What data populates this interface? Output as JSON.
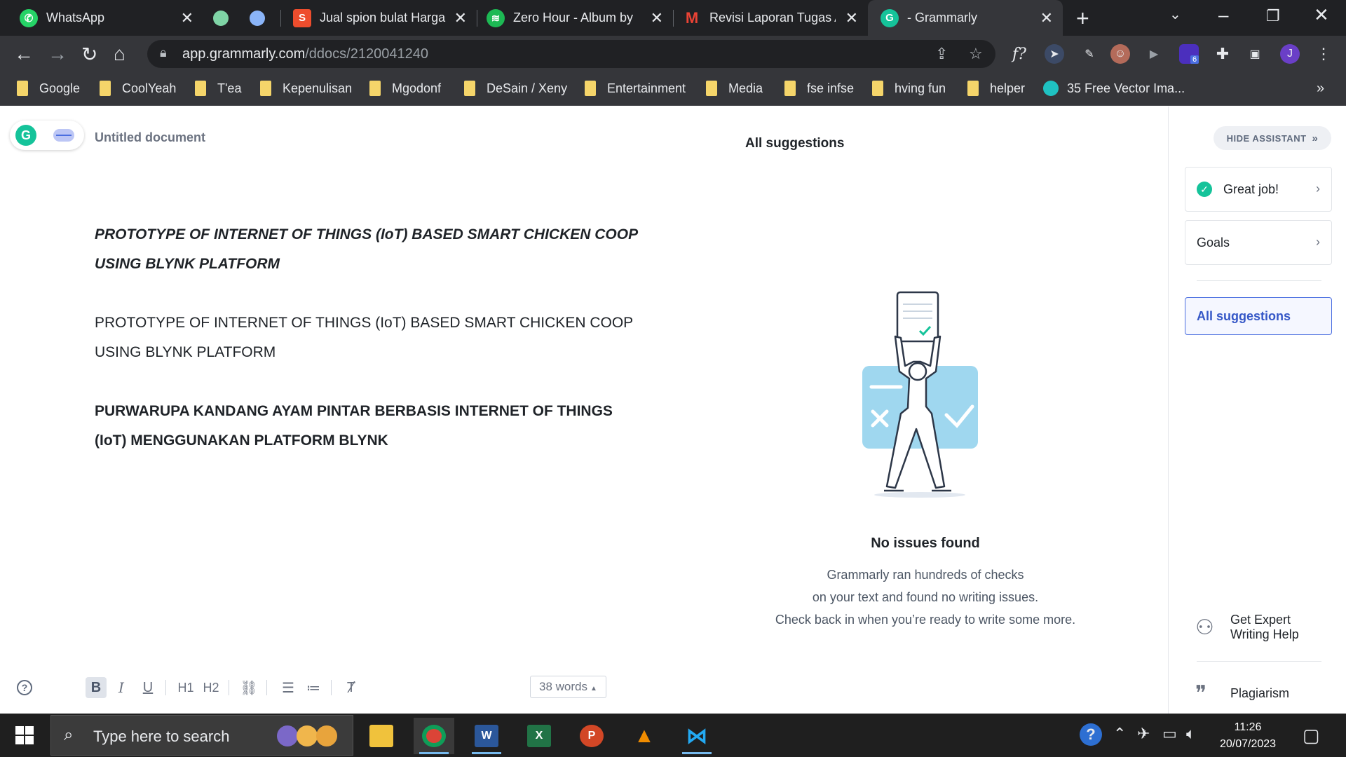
{
  "browser": {
    "tabs": [
      {
        "title": "WhatsApp",
        "icon": "whatsapp-icon",
        "color": "#25d366"
      },
      {
        "title": "",
        "icon": "circle-green-icon",
        "color": "#7fd4a6"
      },
      {
        "title": "",
        "icon": "circle-blue-icon",
        "color": "#8ab4f8"
      },
      {
        "title": "Jual spion bulat Harga",
        "icon": "shopee-icon",
        "color": "#ee4d2d"
      },
      {
        "title": "Zero Hour - Album by",
        "icon": "spotify-icon",
        "color": "#1db954"
      },
      {
        "title": "Revisi Laporan Tugas A",
        "icon": "gmail-icon",
        "color": "#ea4335"
      },
      {
        "title": "- Grammarly",
        "icon": "grammarly-icon",
        "color": "#15c39a"
      }
    ],
    "url_host": "app.grammarly.com",
    "url_path": "/ddocs/2120041240",
    "bookmarks": [
      "Google",
      "CoolYeah",
      "T'ea",
      "Kepenulisan",
      "Mgodonf",
      "DeSain / Xeny",
      "Entertainment",
      "Media",
      "fse infse",
      "hving fun",
      "helper",
      "35 Free Vector Ima..."
    ],
    "extension_badge": "6",
    "profile_initial": "J",
    "fx_label": "f?"
  },
  "editor": {
    "doc_title": "Untitled document",
    "paragraphs": [
      "PROTOTYPE OF INTERNET OF THINGS (IoT) BASED SMART CHICKEN COOP USING BLYNK PLATFORM",
      "PROTOTYPE OF INTERNET OF THINGS (IoT) BASED SMART CHICKEN COOP USING BLYNK PLATFORM",
      "PURWARUPA KANDANG AYAM PINTAR BERBASIS INTERNET OF THINGS (IoT) MENGGUNAKAN PLATFORM BLYNK"
    ],
    "word_count": "38 words",
    "format_buttons": [
      "B",
      "I",
      "U",
      "H1",
      "H2"
    ]
  },
  "suggestions": {
    "header": "All suggestions",
    "empty_title": "No issues found",
    "empty_lines": [
      "Grammarly ran hundreds of checks",
      "on your text and found no writing issues.",
      "Check back in when you’re ready to write some more."
    ]
  },
  "assistant": {
    "hide_label": "HIDE ASSISTANT",
    "great_job": "Great job!",
    "goals": "Goals",
    "all_suggestions": "All suggestions",
    "expert_line1": "Get Expert",
    "expert_line2": "Writing Help",
    "plagiarism": "Plagiarism"
  },
  "taskbar": {
    "search_placeholder": "Type here to search",
    "time": "11:26",
    "date": "20/07/2023",
    "apps": [
      "file-explorer-icon",
      "chrome-icon",
      "word-icon",
      "excel-icon",
      "powerpoint-icon",
      "vlc-icon",
      "vscode-icon"
    ]
  },
  "colors": {
    "grammarly_green": "#15c39a",
    "selected_blue": "#4a6ee0",
    "chrome_dark": "#202124",
    "chrome_toolbar": "#35363a"
  }
}
